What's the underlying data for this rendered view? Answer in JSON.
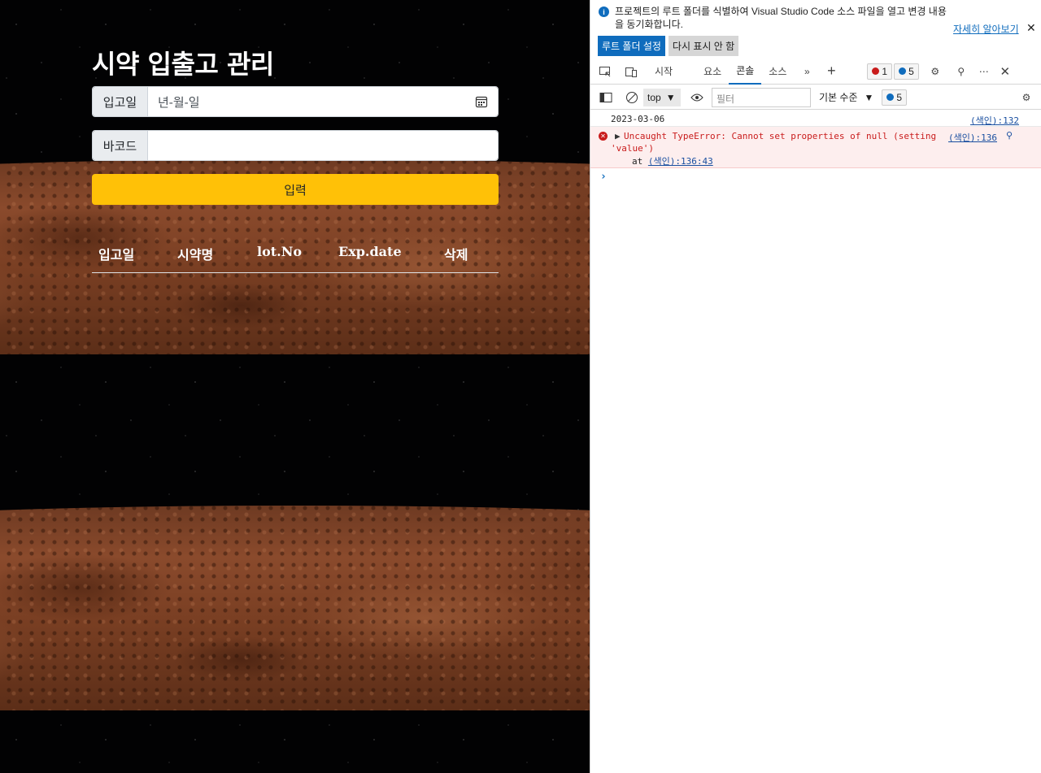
{
  "app": {
    "title": "시약 입출고 관리",
    "date_label": "입고일",
    "date_placeholder": "년-월-일",
    "barcode_label": "바코드",
    "barcode_value": "",
    "submit_label": "입력",
    "table_headers": [
      "입고일",
      "시약명",
      "lot.No",
      "Exp.date",
      "삭제"
    ],
    "accent_color": "#ffc107"
  },
  "devtools": {
    "infobar": {
      "message": "프로젝트의 루트 폴더를 식별하여 Visual Studio Code 소스 파일을 열고 변경 내용을 동기화합니다.",
      "learn_more": "자세히 알아보기",
      "set_root_button": "루트 폴더 설정",
      "dont_show_button": "다시 표시 안 함"
    },
    "tabs": [
      "시작",
      "요소",
      "콘솔",
      "소스"
    ],
    "active_tab": "콘솔",
    "error_count": "1",
    "message_count": "5",
    "toolbar": {
      "context": "top",
      "filter_placeholder": "필터",
      "level": "기본 수준",
      "issue_count": "5"
    },
    "console": {
      "log": {
        "message": "2023-03-06",
        "source": "(색인):132"
      },
      "error": {
        "line1": "Uncaught TypeError: Cannot set properties of null (setting",
        "line2": "'value')",
        "at": "at",
        "at_link": "(색인):136:43",
        "source": "(색인):136"
      }
    }
  }
}
